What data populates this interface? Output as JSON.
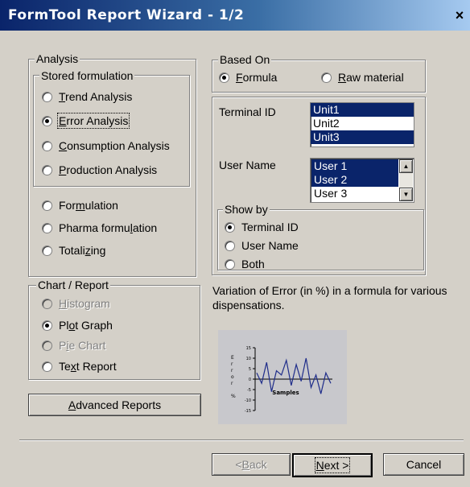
{
  "window": {
    "title": "FormTool Report Wizard  -  1/2",
    "close_glyph": "×"
  },
  "analysis": {
    "legend": "Analysis",
    "stored_legend": "Stored formulation",
    "stored_items": [
      {
        "prefix": "",
        "ul": "T",
        "rest": "rend Analysis",
        "checked": false
      },
      {
        "prefix": "",
        "ul": "E",
        "rest": "rror Analysis",
        "checked": true
      },
      {
        "prefix": "",
        "ul": "C",
        "rest": "onsumption Analysis",
        "checked": false
      },
      {
        "prefix": "",
        "ul": "P",
        "rest": "roduction Analysis",
        "checked": false
      }
    ],
    "other_items": [
      {
        "prefix": "For",
        "ul": "m",
        "rest": "ulation",
        "checked": false
      },
      {
        "prefix": "Pharma formu",
        "ul": "l",
        "rest": "ation",
        "checked": false
      },
      {
        "prefix": "Totali",
        "ul": "z",
        "rest": "ing",
        "checked": false
      }
    ]
  },
  "chart_report": {
    "legend": "Chart / Report",
    "items": [
      {
        "prefix": "",
        "ul": "H",
        "rest": "istogram",
        "checked": false,
        "disabled": true
      },
      {
        "prefix": "Pl",
        "ul": "o",
        "rest": "t Graph",
        "checked": true,
        "disabled": false
      },
      {
        "prefix": "P",
        "ul": "i",
        "rest": "e Chart",
        "checked": false,
        "disabled": true
      },
      {
        "prefix": "Te",
        "ul": "x",
        "rest": "t Report",
        "checked": false,
        "disabled": false
      }
    ]
  },
  "advanced_button": {
    "prefix": "",
    "ul": "A",
    "rest": "dvanced Reports"
  },
  "based_on": {
    "legend": "Based On",
    "items": [
      {
        "prefix": "",
        "ul": "F",
        "rest": "ormula",
        "checked": true
      },
      {
        "prefix": "",
        "ul": "R",
        "rest": "aw material",
        "checked": false
      }
    ]
  },
  "terminal": {
    "label": "Terminal ID",
    "items": [
      {
        "text": "Unit1",
        "selected": true
      },
      {
        "text": "Unit2",
        "selected": false
      },
      {
        "text": "Unit3",
        "selected": true
      }
    ]
  },
  "user": {
    "label": "User Name",
    "items": [
      {
        "text": "User 1",
        "selected": true
      },
      {
        "text": "User 2",
        "selected": true
      },
      {
        "text": "User 3",
        "selected": false
      }
    ],
    "scroll_up_glyph": "▲",
    "scroll_down_glyph": "▼"
  },
  "show_by": {
    "legend": "Show by",
    "items": [
      {
        "text": "Terminal ID",
        "checked": true
      },
      {
        "text": "User Name",
        "checked": false
      },
      {
        "text": "Both",
        "checked": false
      }
    ]
  },
  "description": "Variation of Error (in %) in a formula for various dispensations.",
  "preview_graph": {
    "y_axis_letters": [
      "E",
      "r",
      "r",
      "o",
      "r",
      "",
      "%"
    ],
    "y_ticks": [
      "15",
      "10",
      "5",
      "0",
      "-5",
      "-10",
      "-15"
    ],
    "x_label": "Samples",
    "values": [
      3,
      -2,
      8,
      -6,
      4,
      2,
      9,
      -3,
      7,
      -1,
      10,
      -4,
      2,
      -7,
      3,
      -2
    ]
  },
  "footer": {
    "back": {
      "prefix": "< ",
      "ul": "B",
      "rest": "ack"
    },
    "next": {
      "prefix": "",
      "ul": "N",
      "rest": "ext >"
    },
    "cancel": "Cancel"
  }
}
